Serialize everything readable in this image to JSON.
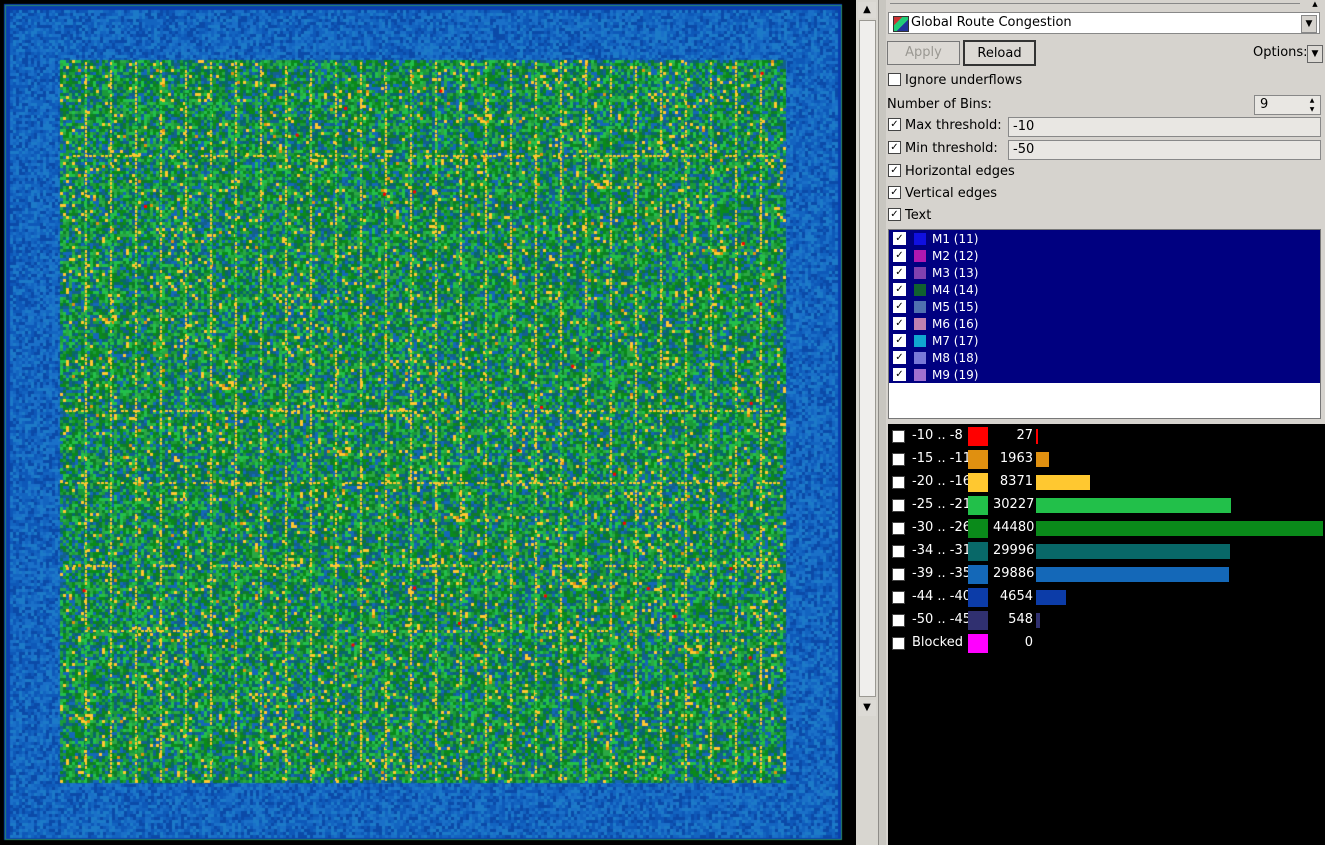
{
  "map": {
    "description_key": "congestion-heatmap"
  },
  "panel": {
    "mode_select": {
      "icon": "route-congestion-icon",
      "value": "Global Route Congestion"
    },
    "apply_label": "Apply",
    "reload_label": "Reload",
    "options_label": "Options:",
    "ignore_underflows": {
      "label": "Ignore underflows",
      "checked": false
    },
    "num_bins": {
      "label": "Number of Bins:",
      "value": "9"
    },
    "max_threshold": {
      "label": "Max threshold:",
      "value": "-10",
      "checked": true
    },
    "min_threshold": {
      "label": "Min threshold:",
      "value": "-50",
      "checked": true
    },
    "horizontal_edges": {
      "label": "Horizontal edges",
      "checked": true
    },
    "vertical_edges": {
      "label": "Vertical edges",
      "checked": true
    },
    "text": {
      "label": "Text",
      "checked": true
    }
  },
  "layers": [
    {
      "label": "M1 (11)",
      "color": "#1010e0"
    },
    {
      "label": "M2 (12)",
      "color": "#b018b0"
    },
    {
      "label": "M3 (13)",
      "color": "#8040b0"
    },
    {
      "label": "M4 (14)",
      "color": "#106030"
    },
    {
      "label": "M5 (15)",
      "color": "#5070b0"
    },
    {
      "label": "M6 (16)",
      "color": "#c080b0"
    },
    {
      "label": "M7 (17)",
      "color": "#10a8d0"
    },
    {
      "label": "M8 (18)",
      "color": "#7878d8"
    },
    {
      "label": "M9 (19)",
      "color": "#a070d0"
    }
  ],
  "histogram": [
    {
      "range": "-10 .. -8",
      "color": "#ff0000",
      "count": "27",
      "value": 27,
      "checked": true
    },
    {
      "range": "-15 .. -11",
      "color": "#e09010",
      "count": "1963",
      "value": 1963,
      "checked": true
    },
    {
      "range": "-20 .. -16",
      "color": "#ffc830",
      "count": "8371",
      "value": 8371,
      "checked": true
    },
    {
      "range": "-25 .. -21",
      "color": "#22c04a",
      "count": "30227",
      "value": 30227,
      "checked": true
    },
    {
      "range": "-30 .. -26",
      "color": "#0a8a1a",
      "count": "44480",
      "value": 44480,
      "checked": true
    },
    {
      "range": "-34 .. -31",
      "color": "#086868",
      "count": "29996",
      "value": 29996,
      "checked": true
    },
    {
      "range": "-39 .. -35",
      "color": "#1468b8",
      "count": "29886",
      "value": 29886,
      "checked": true
    },
    {
      "range": "-44 .. -40",
      "color": "#0c3ca8",
      "count": "4654",
      "value": 4654,
      "checked": true
    },
    {
      "range": "-50 .. -45",
      "color": "#303070",
      "count": "548",
      "value": 548,
      "checked": true
    },
    {
      "range": "Blocked",
      "color": "#ff00ff",
      "count": "0",
      "value": 0,
      "checked": false
    }
  ]
}
